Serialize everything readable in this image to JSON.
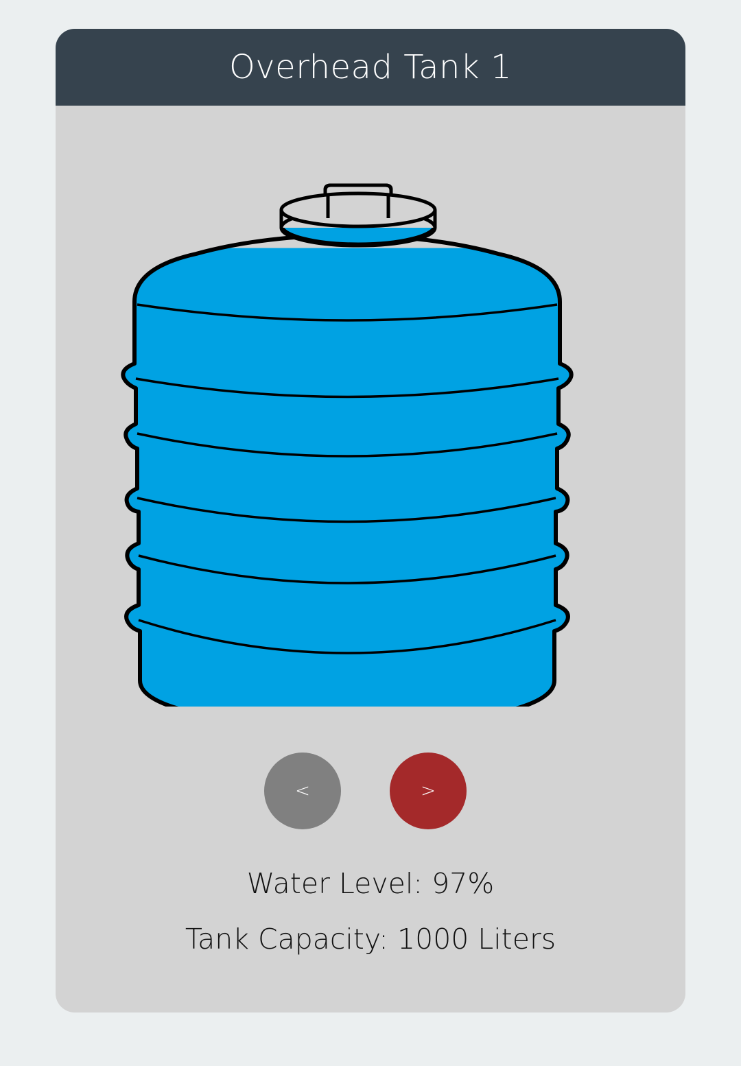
{
  "tank": {
    "title": "Overhead Tank 1",
    "water_level_label": "Water Level:",
    "water_level_value": "97%",
    "water_level_percent": 97,
    "capacity_label": "Tank Capacity:",
    "capacity_value": "1000 Liters"
  },
  "nav": {
    "prev_label": "<",
    "next_label": ">"
  },
  "colors": {
    "page_background": "#ebeff0",
    "card_background": "#d3d3d3",
    "header_background": "#36434e",
    "water": "#00a2e3",
    "prev_button": "#808080",
    "next_button": "#a4292a"
  },
  "icons": {
    "tank": "water-tank-icon"
  }
}
